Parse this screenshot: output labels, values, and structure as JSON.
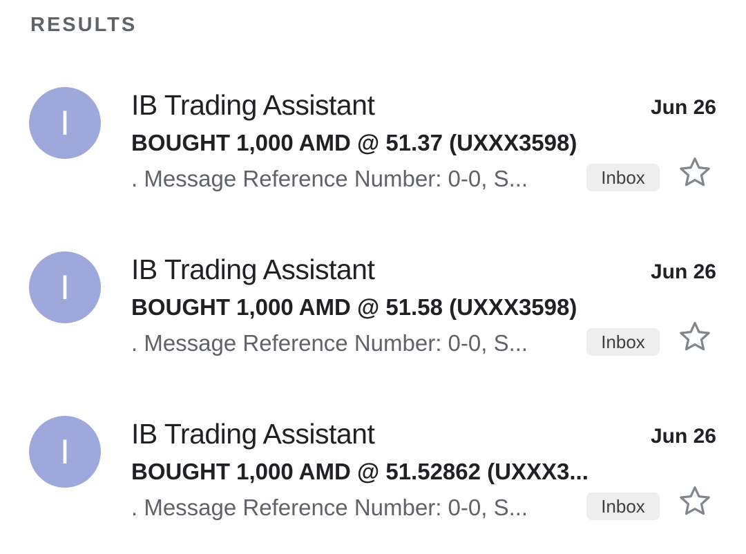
{
  "section_header": "RESULTS",
  "emails": [
    {
      "avatar_letter": "I",
      "sender": "IB Trading Assistant",
      "date": "Jun 26",
      "subject": "BOUGHT 1,000 AMD @ 51.37 (UXXX3598)",
      "snippet": ". Message Reference Number: 0-0, S...",
      "label": "Inbox",
      "starred": false
    },
    {
      "avatar_letter": "I",
      "sender": "IB Trading Assistant",
      "date": "Jun 26",
      "subject": "BOUGHT 1,000 AMD @ 51.58 (UXXX3598)",
      "snippet": ". Message Reference Number: 0-0, S...",
      "label": "Inbox",
      "starred": false
    },
    {
      "avatar_letter": "I",
      "sender": "IB Trading Assistant",
      "date": "Jun 26",
      "subject": "BOUGHT 1,000 AMD @ 51.52862 (UXXX3...",
      "snippet": ". Message Reference Number: 0-0, S...",
      "label": "Inbox",
      "starred": false
    }
  ],
  "colors": {
    "avatar_bg": "#9fa8da",
    "chip_bg": "#eeeeee",
    "star_outline": "#80868b"
  },
  "icons": {
    "star": "star-outline-icon"
  }
}
